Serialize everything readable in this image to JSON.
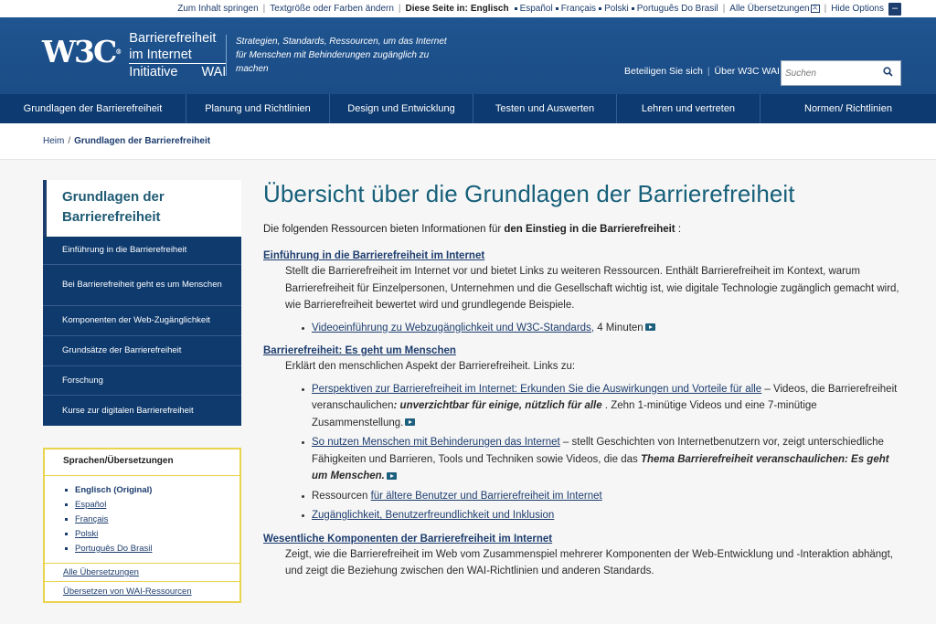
{
  "util": {
    "skip": "Zum Inhalt springen",
    "textsize": "Textgröße oder Farben ändern",
    "this_page": "Diese Seite in:",
    "langs": [
      "Englisch",
      "Español",
      "Français",
      "Polski",
      "Português Do Brasil"
    ],
    "all_translations": "Alle Übersetzungen",
    "translations_icon": "translation-icon",
    "hide": "Hide Options",
    "hide_icon_char": "–"
  },
  "header": {
    "logo_w3c": "W3C",
    "logo_line1": "Barrierefreiheit",
    "logo_line2": "im Internet",
    "logo_initiative": "Initiative",
    "logo_wai": "WAI",
    "tagline": "Strategien, Standards, Ressourcen, um das Internet für Menschen mit Behinderungen zugänglich zu machen",
    "link_participate": "Beteiligen Sie sich",
    "link_about": "Über W3C WAI",
    "search_placeholder": "Suchen",
    "search_icon": "magnifier-icon"
  },
  "nav": [
    "Grundlagen der Barrierefreiheit",
    "Planung und Richtlinien",
    "Design und Entwicklung",
    "Testen und Auswerten",
    "Lehren und vertreten",
    "Normen/ Richtlinien"
  ],
  "breadcrumb": {
    "home": "Heim",
    "current": "Grundlagen der Barrierefreiheit"
  },
  "sidebar": {
    "title": "Grundlagen der Barrierefreiheit",
    "items": [
      "Einführung in die Barrierefreiheit",
      "Bei Barrierefreiheit geht es um Menschen",
      "Komponenten der Web-Zugänglichkeit",
      "Grundsätze der Barrierefreiheit",
      "Forschung",
      "Kurse zur digitalen Barrierefreiheit"
    ]
  },
  "langbox": {
    "title": "Sprachen/Übersetzungen",
    "original": "Englisch (Original)",
    "langs": [
      "Español",
      "Français",
      "Polski",
      "Português Do Brasil"
    ],
    "all": "Alle Übersetzungen",
    "translate": "Übersetzen von WAI-Ressourcen"
  },
  "main": {
    "title": "Übersicht über die Grundlagen der Barrierefreiheit",
    "intro_pre": "Die folgenden Ressourcen bieten Informationen für",
    "intro_bold": "den Einstieg in die Barrierefreiheit",
    "intro_post": ":",
    "sec1": {
      "heading": "Einführung in die Barrierefreiheit im Internet",
      "desc": "Stellt die Barrierefreiheit im Internet vor und bietet Links zu weiteren Ressourcen. Enthält Barrierefreiheit im Kontext, warum Barrierefreiheit für Einzelpersonen, Unternehmen und die Gesellschaft wichtig ist, wie digitale Technologie zugänglich gemacht wird, wie Barrierefreiheit bewertet wird und grundlegende Beispiele.",
      "item_link": "Videoeinführung zu Webzugänglichkeit und W3C-Standards,",
      "item_post": "4 Minuten"
    },
    "sec2": {
      "heading": "Barrierefreiheit: Es geht um Menschen",
      "desc": "Erklärt den menschlichen Aspekt der Barrierefreiheit. Links zu:",
      "i1_link": "Perspektiven zur Barrierefreiheit im Internet: Erkunden Sie die Auswirkungen und Vorteile für alle",
      "i1_post": "– Videos, die Barrierefreiheit veranschaulichen",
      "i1_em": ": unverzichtbar für einige, nützlich für alle",
      "i1_tail": ". Zehn 1-minütige Videos und eine 7-minütige Zusammenstellung.",
      "i2_link": "So nutzen Menschen mit Behinderungen das Internet",
      "i2_post": "– stellt Geschichten von Internetbenutzern vor, zeigt unterschiedliche Fähigkeiten und Barrieren, Tools und Techniken sowie Videos, die das",
      "i2_em": "Thema Barrierefreiheit veranschaulichen: Es geht um Menschen.",
      "i3_pre": "Ressourcen",
      "i3_link": "für ältere Benutzer und Barrierefreiheit im Internet",
      "i4_link": "Zugänglichkeit, Benutzerfreundlichkeit und Inklusion"
    },
    "sec3": {
      "heading": "Wesentliche Komponenten der Barrierefreiheit im Internet",
      "desc": "Zeigt, wie die Barrierefreiheit im Web vom Zusammenspiel mehrerer Komponenten der Web-Entwicklung und -Interaktion abhängt, und zeigt die Beziehung zwischen den WAI-Richtlinien und anderen Standards."
    }
  }
}
